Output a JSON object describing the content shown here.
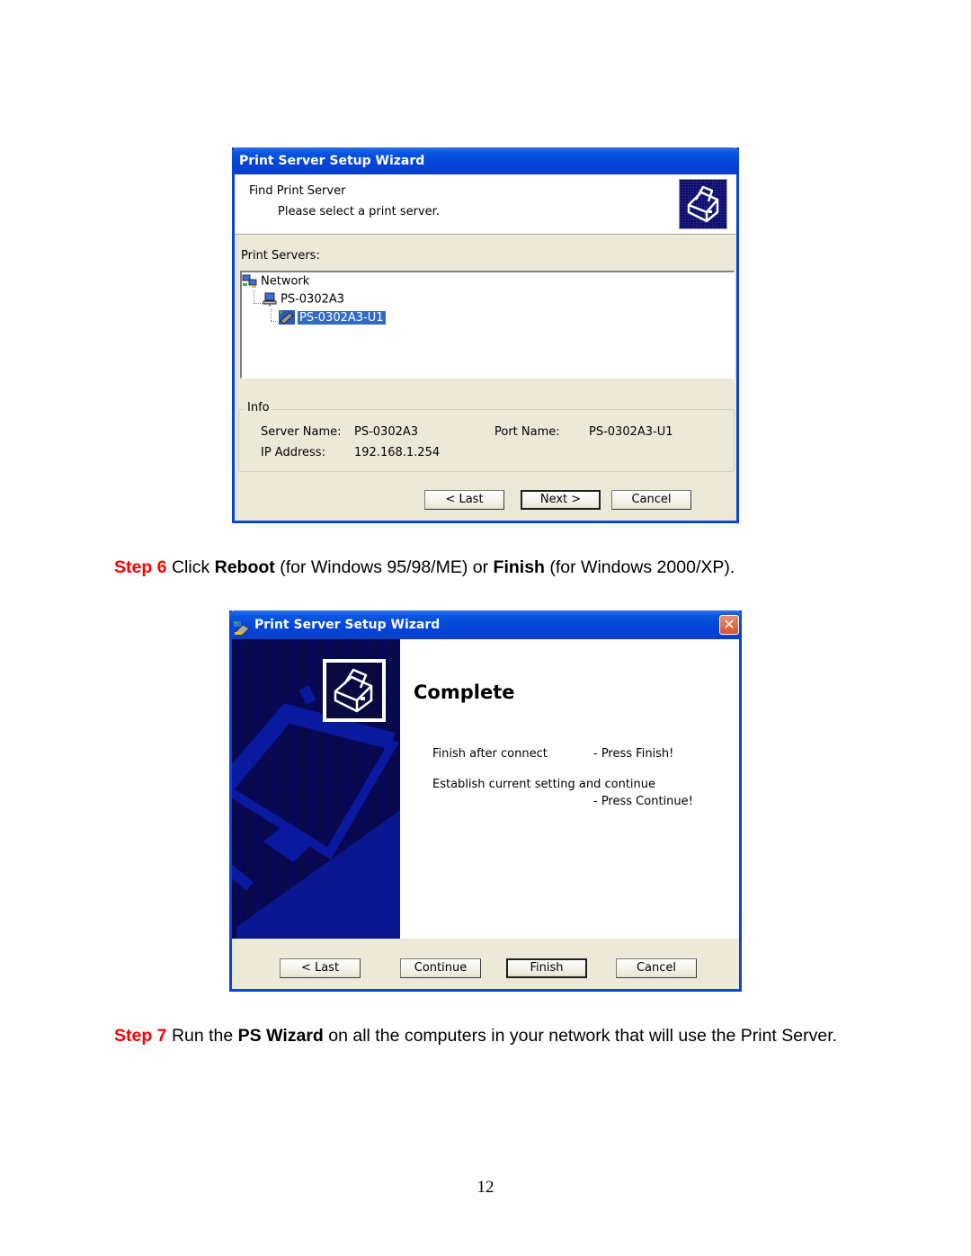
{
  "wizard1": {
    "title": "Print Server Setup Wizard",
    "header_title": "Find Print Server",
    "header_subtitle": "Please select a print server.",
    "servers_label": "Print Servers:",
    "tree": {
      "root": "Network",
      "server": "PS-0302A3",
      "port": "PS-0302A3-U1"
    },
    "info": {
      "legend": "Info",
      "server_name_label": "Server Name:",
      "server_name_value": "PS-0302A3",
      "port_name_label": "Port Name:",
      "port_name_value": "PS-0302A3-U1",
      "ip_label": "IP Address:",
      "ip_value": "192.168.1.254"
    },
    "buttons": {
      "last": "< Last",
      "next": "Next >",
      "cancel": "Cancel"
    }
  },
  "step6": {
    "num": "Step 6",
    "t1": " Click ",
    "b1": "Reboot",
    "t2": " (for Windows 95/98/ME) or ",
    "b2": "Finish",
    "t3": " (for Windows 2000/XP)."
  },
  "wizard2": {
    "title": "Print Server Setup Wizard",
    "close": "✕",
    "heading": "Complete",
    "line1_left": "Finish after connect",
    "line1_right": "- Press Finish!",
    "line2_left": "Establish current setting and continue",
    "line2_right": "- Press Continue!",
    "buttons": {
      "last": "< Last",
      "continue": "Continue",
      "finish": "Finish",
      "cancel": "Cancel"
    }
  },
  "step7": {
    "num": "Step 7",
    "t1": " Run the ",
    "b1": "PS Wizard",
    "t2": " on all the computers in your network that will use the Print Server."
  },
  "page_number": "12"
}
